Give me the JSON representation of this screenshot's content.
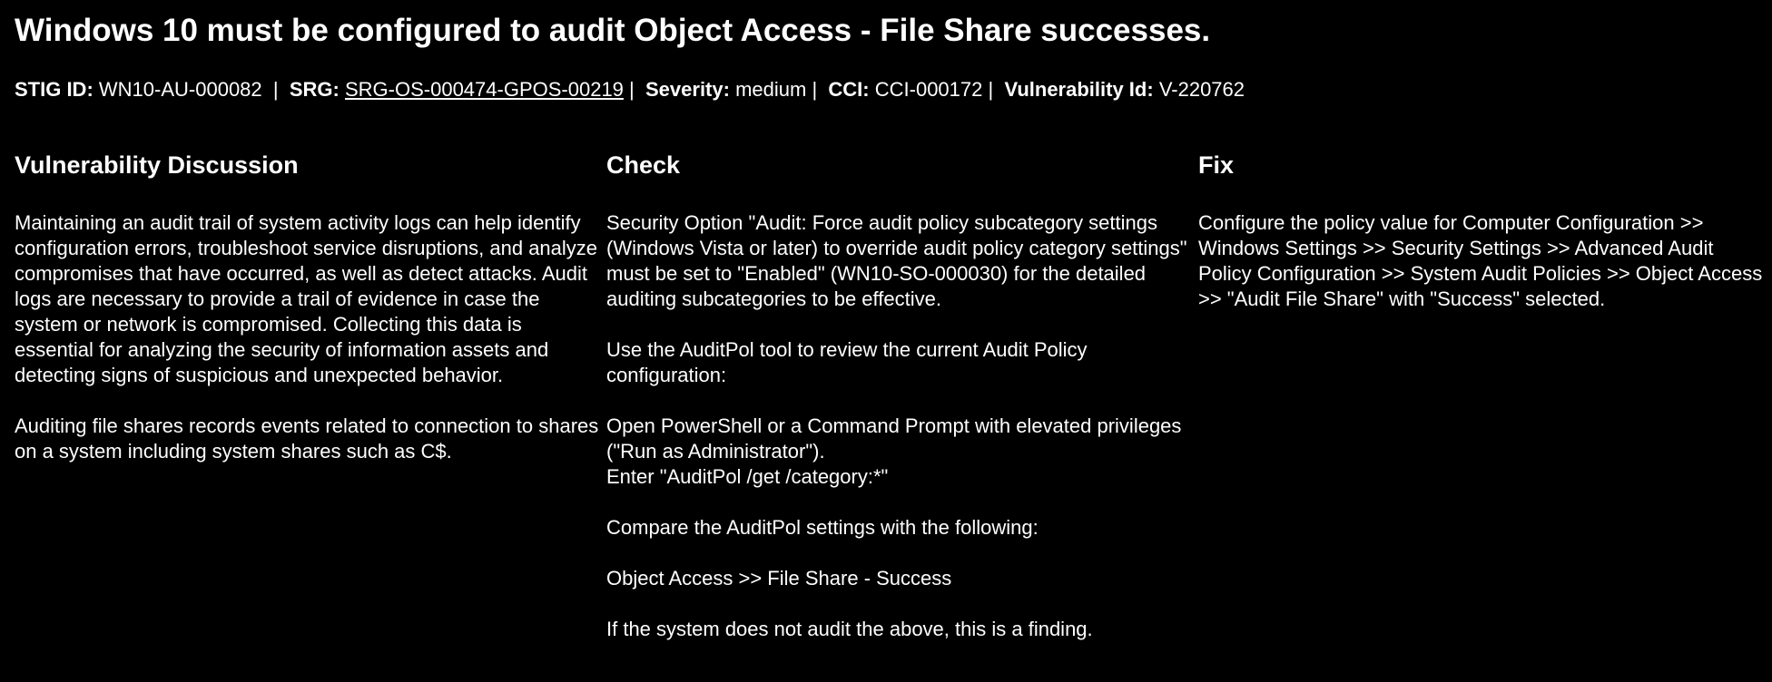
{
  "title": "Windows 10 must be configured to audit Object Access - File Share successes.",
  "meta": {
    "stig_id_label": "STIG ID:",
    "stig_id": "WN10-AU-000082",
    "srg_label": "SRG:",
    "srg": "SRG-OS-000474-GPOS-00219",
    "severity_label": "Severity:",
    "severity": "medium",
    "cci_label": "CCI:",
    "cci": "CCI-000172",
    "vuln_label": "Vulnerability Id:",
    "vuln_id": "V-220762"
  },
  "discussion": {
    "heading": "Vulnerability Discussion",
    "paragraphs": [
      "Maintaining an audit trail of system activity logs can help identify configuration errors, troubleshoot service disruptions, and analyze compromises that have occurred, as well as detect attacks. Audit logs are necessary to provide a trail of evidence in case the system or network is compromised. Collecting this data is essential for analyzing the security of information assets and detecting signs of suspicious and unexpected behavior.",
      "Auditing file shares records events related to connection to shares on a system including system shares such as C$."
    ]
  },
  "check": {
    "heading": "Check",
    "paragraphs": [
      "Security Option \"Audit: Force audit policy subcategory settings (Windows Vista or later) to override audit policy category settings\" must be set to \"Enabled\" (WN10-SO-000030) for the detailed auditing subcategories to be effective.",
      "Use the AuditPol tool to review the current Audit Policy configuration:",
      "Open PowerShell or a Command Prompt with elevated privileges (\"Run as Administrator\").",
      "Enter \"AuditPol /get /category:*\"",
      "Compare the AuditPol settings with the following:",
      "Object Access >> File Share - Success",
      "If the system does not audit the above, this is a finding."
    ]
  },
  "fix": {
    "heading": "Fix",
    "paragraphs": [
      "Configure the policy value for Computer Configuration >> Windows Settings >> Security Settings >> Advanced Audit Policy Configuration >> System Audit Policies >> Object Access >> \"Audit File Share\" with \"Success\" selected."
    ]
  }
}
